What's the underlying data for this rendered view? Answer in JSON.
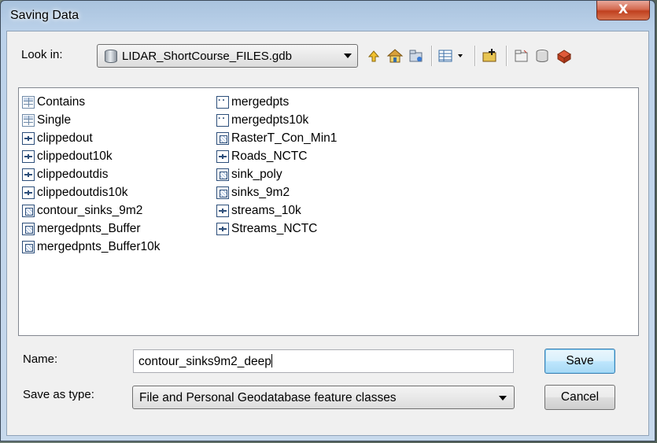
{
  "window": {
    "title": "Saving Data",
    "close_glyph": "X"
  },
  "toolbar": {
    "lookin_label": "Look in:",
    "lookin_value": "LIDAR_ShortCourse_FILES.gdb",
    "icons": [
      "up-one-level-icon",
      "home-icon",
      "connect-folder-icon",
      "view-menu-icon",
      "new-feature-dataset-icon",
      "new-folder-icon",
      "new-geodatabase-icon",
      "catalog-options-icon"
    ]
  },
  "files": {
    "col1": [
      {
        "name": "Contains",
        "type": "table"
      },
      {
        "name": "Single",
        "type": "table"
      },
      {
        "name": "clippedout",
        "type": "line"
      },
      {
        "name": "clippedout10k",
        "type": "line"
      },
      {
        "name": "clippedoutdis",
        "type": "line"
      },
      {
        "name": "clippedoutdis10k",
        "type": "line"
      },
      {
        "name": "contour_sinks_9m2",
        "type": "poly"
      },
      {
        "name": "mergedpnts_Buffer",
        "type": "poly"
      },
      {
        "name": "mergedpnts_Buffer10k",
        "type": "poly"
      }
    ],
    "col2": [
      {
        "name": "mergedpts",
        "type": "point"
      },
      {
        "name": "mergedpts10k",
        "type": "point"
      },
      {
        "name": "RasterT_Con_Min1",
        "type": "poly"
      },
      {
        "name": "Roads_NCTC",
        "type": "line"
      },
      {
        "name": "sink_poly",
        "type": "poly"
      },
      {
        "name": "sinks_9m2",
        "type": "poly"
      },
      {
        "name": "streams_10k",
        "type": "line"
      },
      {
        "name": "Streams_NCTC",
        "type": "line"
      }
    ]
  },
  "form": {
    "name_label": "Name:",
    "name_value": "contour_sinks9m2_deep",
    "type_label": "Save as type:",
    "type_value": "File and Personal Geodatabase feature classes"
  },
  "buttons": {
    "save": "Save",
    "cancel": "Cancel"
  }
}
